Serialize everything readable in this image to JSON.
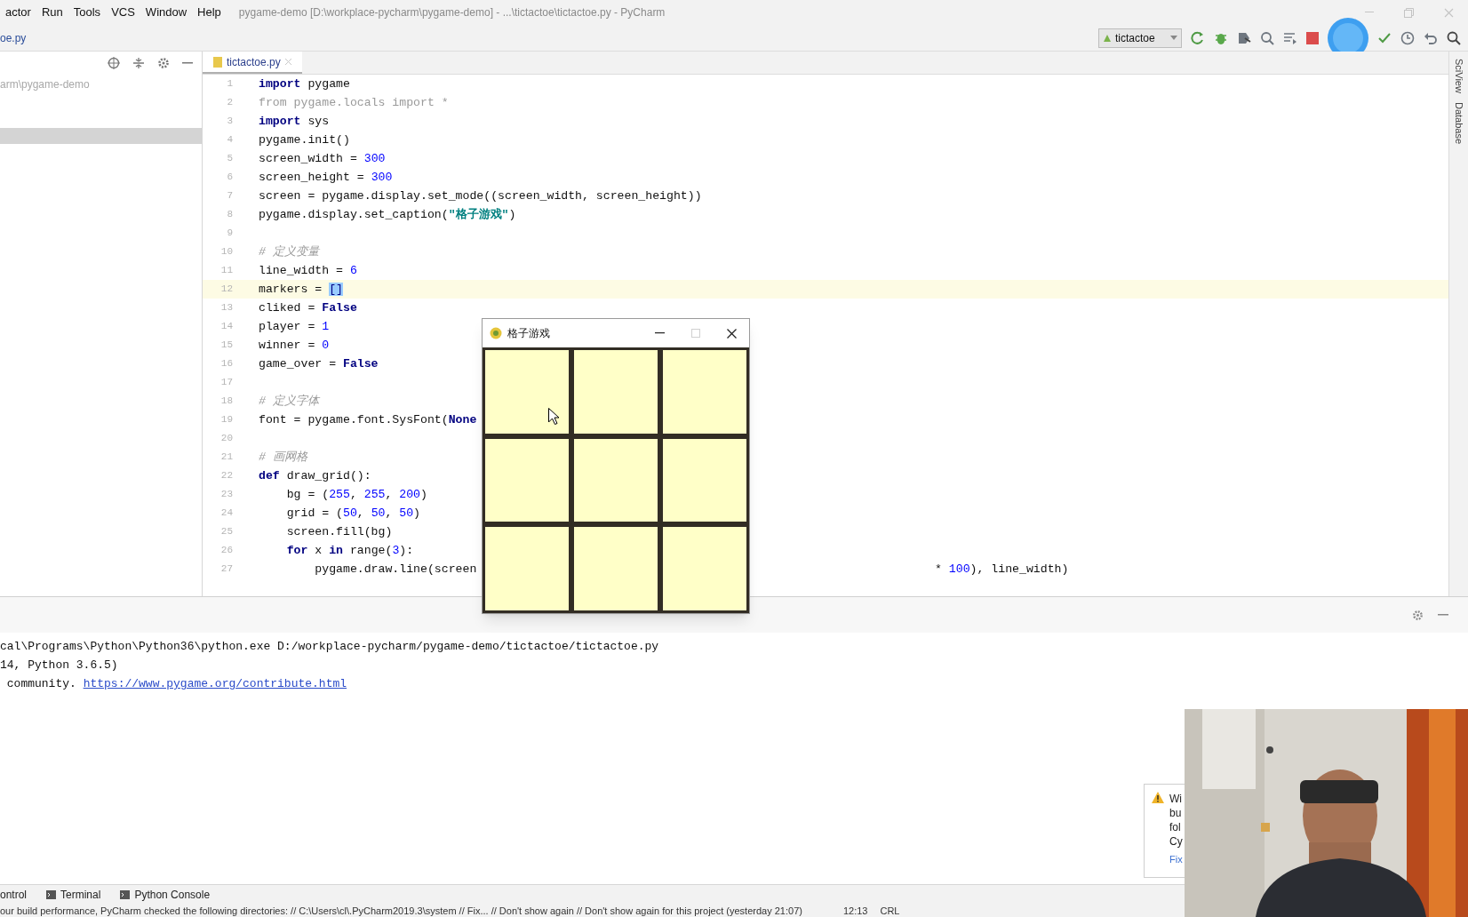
{
  "menu_bar": {
    "items": [
      "actor",
      "Run",
      "Tools",
      "VCS",
      "Window",
      "Help"
    ],
    "title": "pygame-demo [D:\\workplace-pycharm\\pygame-demo] - ...\\tictactoe\\tictactoe.py - PyCharm"
  },
  "navigation_bar": {
    "breadcrumb": "oe.py",
    "run_config": "tictactoe"
  },
  "project_panel": {
    "path": "arm\\pygame-demo"
  },
  "editor": {
    "tabs": [
      {
        "label": "tictactoe.py",
        "selected": true
      }
    ],
    "lines": [
      {
        "number": "1",
        "kind": "code",
        "current": false,
        "segments": [
          {
            "text": "import",
            "kind": "keyword"
          },
          {
            "text": " pygame",
            "kind": "plain"
          }
        ]
      },
      {
        "number": "2",
        "kind": "code",
        "current": false,
        "segments": [
          {
            "text": "from pygame.locals import *",
            "kind": "unused"
          }
        ]
      },
      {
        "number": "3",
        "kind": "code",
        "current": false,
        "segments": [
          {
            "text": "import",
            "kind": "keyword"
          },
          {
            "text": " sys",
            "kind": "plain"
          }
        ]
      },
      {
        "number": "4",
        "kind": "code",
        "current": false,
        "segments": [
          {
            "text": "pygame.init()",
            "kind": "plain"
          }
        ]
      },
      {
        "number": "5",
        "kind": "code",
        "current": false,
        "segments": [
          {
            "text": "screen_width = ",
            "kind": "plain"
          },
          {
            "text": "300",
            "kind": "number"
          }
        ]
      },
      {
        "number": "6",
        "kind": "code",
        "current": false,
        "segments": [
          {
            "text": "screen_height = ",
            "kind": "plain"
          },
          {
            "text": "300",
            "kind": "number"
          }
        ]
      },
      {
        "number": "7",
        "kind": "code",
        "current": false,
        "segments": [
          {
            "text": "screen = pygame.display.set_mode((screen_width, screen_height))",
            "kind": "plain"
          }
        ]
      },
      {
        "number": "8",
        "kind": "code",
        "current": false,
        "segments": [
          {
            "text": "pygame.display.set_caption(",
            "kind": "plain"
          },
          {
            "text": "\"格子游戏\"",
            "kind": "string"
          },
          {
            "text": ")",
            "kind": "plain"
          }
        ]
      },
      {
        "number": "9",
        "kind": "blank",
        "current": false
      },
      {
        "number": "10",
        "kind": "code",
        "current": false,
        "segments": [
          {
            "text": "# 定义变量",
            "kind": "comment"
          }
        ]
      },
      {
        "number": "11",
        "kind": "code",
        "current": false,
        "segments": [
          {
            "text": "line_width = ",
            "kind": "plain"
          },
          {
            "text": "6",
            "kind": "number"
          }
        ]
      },
      {
        "number": "12",
        "kind": "code",
        "current": true,
        "segments": [
          {
            "text": "markers = ",
            "kind": "plain"
          },
          {
            "text": "[]",
            "kind": "match"
          }
        ]
      },
      {
        "number": "13",
        "kind": "code",
        "current": false,
        "segments": [
          {
            "text": "cliked = ",
            "kind": "plain"
          },
          {
            "text": "False",
            "kind": "keyword"
          }
        ]
      },
      {
        "number": "14",
        "kind": "code",
        "current": false,
        "segments": [
          {
            "text": "player = ",
            "kind": "plain"
          },
          {
            "text": "1",
            "kind": "number"
          }
        ]
      },
      {
        "number": "15",
        "kind": "code",
        "current": false,
        "segments": [
          {
            "text": "winner = ",
            "kind": "plain"
          },
          {
            "text": "0",
            "kind": "number"
          }
        ]
      },
      {
        "number": "16",
        "kind": "code",
        "current": false,
        "segments": [
          {
            "text": "game_over = ",
            "kind": "plain"
          },
          {
            "text": "False",
            "kind": "keyword"
          }
        ]
      },
      {
        "number": "17",
        "kind": "blank",
        "current": false
      },
      {
        "number": "18",
        "kind": "code",
        "current": false,
        "segments": [
          {
            "text": "# 定义字体",
            "kind": "comment"
          }
        ]
      },
      {
        "number": "19",
        "kind": "code",
        "current": false,
        "segments": [
          {
            "text": "font = pygame.font.SysFont(",
            "kind": "plain"
          },
          {
            "text": "None",
            "kind": "keyword"
          }
        ]
      },
      {
        "number": "20",
        "kind": "blank",
        "current": false
      },
      {
        "number": "21",
        "kind": "code",
        "current": false,
        "segments": [
          {
            "text": "# 画网格",
            "kind": "comment"
          }
        ]
      },
      {
        "number": "22",
        "kind": "code",
        "current": false,
        "segments": [
          {
            "text": "def",
            "kind": "keyword"
          },
          {
            "text": " draw_grid():",
            "kind": "plain"
          }
        ]
      },
      {
        "number": "23",
        "kind": "code",
        "current": false,
        "segments": [
          {
            "text": "    bg = (",
            "kind": "plain"
          },
          {
            "text": "255",
            "kind": "number"
          },
          {
            "text": ", ",
            "kind": "plain"
          },
          {
            "text": "255",
            "kind": "number"
          },
          {
            "text": ", ",
            "kind": "plain"
          },
          {
            "text": "200",
            "kind": "number"
          },
          {
            "text": ")",
            "kind": "plain"
          }
        ]
      },
      {
        "number": "24",
        "kind": "code",
        "current": false,
        "segments": [
          {
            "text": "    grid = (",
            "kind": "plain"
          },
          {
            "text": "50",
            "kind": "number"
          },
          {
            "text": ", ",
            "kind": "plain"
          },
          {
            "text": "50",
            "kind": "number"
          },
          {
            "text": ", ",
            "kind": "plain"
          },
          {
            "text": "50",
            "kind": "number"
          },
          {
            "text": ")",
            "kind": "plain"
          }
        ]
      },
      {
        "number": "25",
        "kind": "code",
        "current": false,
        "segments": [
          {
            "text": "    screen.fill(bg)",
            "kind": "plain"
          }
        ]
      },
      {
        "number": "26",
        "kind": "code",
        "current": false,
        "segments": [
          {
            "text": "    for",
            "kind": "keyword"
          },
          {
            "text": " x ",
            "kind": "plain"
          },
          {
            "text": "in",
            "kind": "keyword"
          },
          {
            "text": " range(",
            "kind": "plain"
          },
          {
            "text": "3",
            "kind": "number"
          },
          {
            "text": "):",
            "kind": "plain"
          }
        ]
      },
      {
        "number": "27",
        "kind": "split",
        "current": false,
        "segments": [
          {
            "text": "        pygame.draw.line(screen",
            "kind": "plain"
          }
        ],
        "right_segments": [
          {
            "text": "* ",
            "kind": "plain"
          },
          {
            "text": "100",
            "kind": "number"
          },
          {
            "text": "), line_width)",
            "kind": "plain"
          }
        ]
      }
    ]
  },
  "game_window": {
    "title": "格子游戏"
  },
  "right_strip": {
    "tools": [
      "SciView",
      "Database"
    ]
  },
  "run_panel": {
    "lines": [
      [
        {
          "text": "cal\\Programs\\Python\\Python36\\python.exe D:/workplace-pycharm/pygame-demo/tictactoe/tictactoe.py",
          "kind": "plain"
        }
      ],
      [
        {
          "text": "14, Python 3.6.5)",
          "kind": "plain"
        }
      ],
      [
        {
          "text": " community. ",
          "kind": "plain"
        },
        {
          "text": "https://www.pygame.org/contribute.html",
          "kind": "link"
        }
      ]
    ]
  },
  "notification": {
    "lines": [
      "Wi",
      "bu",
      "fol",
      "Cy"
    ],
    "link": "Fix"
  },
  "tool_tabs": [
    "ontrol",
    "Terminal",
    "Python Console"
  ],
  "status_bar": {
    "message": "our build performance, PyCharm checked the following directories: // C:\\Users\\cl\\.PyCharm2019.3\\system // Fix... // Don't show again // Don't show again for this project (yesterday 21:07)",
    "time": "12:13",
    "line_separator": "CRL"
  },
  "webcam": {
    "kind": "picture"
  }
}
